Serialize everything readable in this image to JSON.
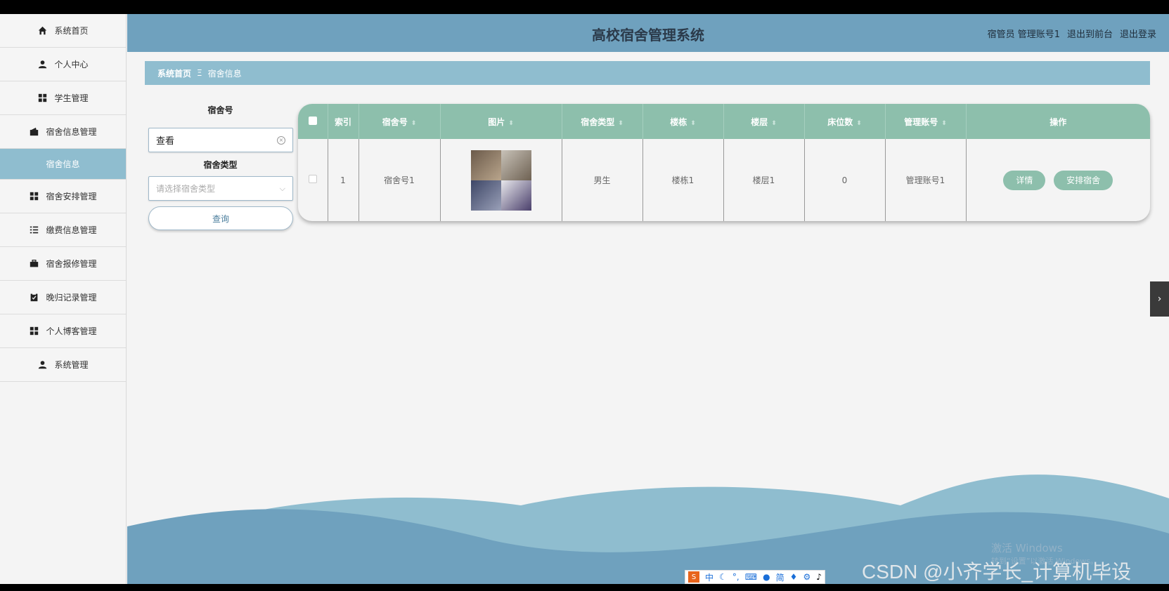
{
  "app": {
    "title": "高校宿舍管理系统",
    "user_info": "宿管员 管理账号1",
    "front_link": "退出到前台",
    "logout_link": "退出登录"
  },
  "sidebar": {
    "items": [
      {
        "label": "系统首页",
        "icon": "home-icon"
      },
      {
        "label": "个人中心",
        "icon": "user-icon"
      },
      {
        "label": "学生管理",
        "icon": "grid-icon"
      },
      {
        "label": "宿舍信息管理",
        "icon": "wallet-icon"
      },
      {
        "label": "宿舍信息",
        "icon": ""
      },
      {
        "label": "宿舍安排管理",
        "icon": "grid-icon"
      },
      {
        "label": "缴费信息管理",
        "icon": "list-icon"
      },
      {
        "label": "宿舍报修管理",
        "icon": "briefcase-icon"
      },
      {
        "label": "晚归记录管理",
        "icon": "clipboard-icon"
      },
      {
        "label": "个人博客管理",
        "icon": "grid-icon"
      },
      {
        "label": "系统管理",
        "icon": "user-icon"
      }
    ]
  },
  "breadcrumb": {
    "home": "系统首页",
    "separator": "Ξ",
    "current": "宿舍信息"
  },
  "search": {
    "room_label": "宿舍号",
    "room_value": "查看",
    "type_label": "宿舍类型",
    "type_placeholder": "请选择宿舍类型",
    "query_button": "查询"
  },
  "table": {
    "headers": {
      "index": "索引",
      "room": "宿舍号",
      "image": "图片",
      "type": "宿舍类型",
      "building": "楼栋",
      "floor": "楼层",
      "beds": "床位数",
      "account": "管理账号",
      "ops": "操作"
    },
    "rows": [
      {
        "index": "1",
        "room": "宿舍号1",
        "type": "男生",
        "building": "楼栋1",
        "floor": "楼层1",
        "beds": "0",
        "account": "管理账号1"
      }
    ],
    "detail_button": "详情",
    "arrange_button": "安排宿舍"
  },
  "taskbar": {
    "ime_items": [
      "中",
      "简"
    ],
    "watermark": "CSDN @小齐学长_计算机毕设",
    "windows_activation": "激活 Windows",
    "windows_activation_sub": "转到“设置”以激活 Windows。"
  },
  "colors": {
    "header": "#6fa1be",
    "breadcrumb": "#8fbdcf",
    "table_header": "#8dbfac",
    "wave_dark": "#6fa1be",
    "wave_light": "#8fbdcf"
  }
}
